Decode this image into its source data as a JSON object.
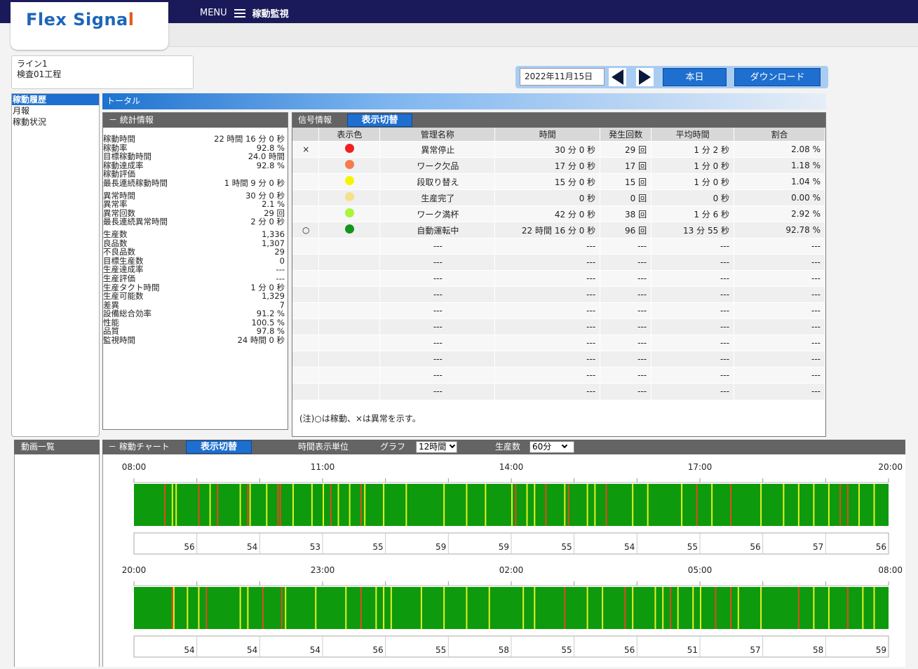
{
  "header": {
    "logo_text_a": "Flex Sig",
    "logo_text_b": "na",
    "logo_text_c": "l",
    "menu_label": "MENU",
    "page_title": "稼動監視"
  },
  "line_info": {
    "line": "ライン1",
    "process": "検査01工程"
  },
  "controls": {
    "date": "2022年11月15日",
    "today_label": "本日",
    "download_label": "ダウンロード"
  },
  "sidebar": {
    "items": [
      {
        "label": "稼動履歴",
        "active": true
      },
      {
        "label": "月報",
        "active": false
      },
      {
        "label": "稼動状況",
        "active": false
      }
    ]
  },
  "total_header": "トータル",
  "stats": {
    "title": "－ 統計情報",
    "groups": [
      [
        {
          "label": "稼動時間",
          "value": "22 時間 16 分 0 秒"
        },
        {
          "label": "稼動率",
          "value": "92.8 %"
        },
        {
          "label": "目標稼動時間",
          "value": "24.0 時間"
        },
        {
          "label": "稼動達成率",
          "value": "92.8 %"
        },
        {
          "label": "稼動評価",
          "value": ""
        },
        {
          "label": "最長連続稼動時間",
          "value": "1 時間 9 分 0 秒"
        }
      ],
      [
        {
          "label": "異常時間",
          "value": "30 分 0 秒"
        },
        {
          "label": "異常率",
          "value": "2.1 %"
        },
        {
          "label": "異常回数",
          "value": "29 回"
        },
        {
          "label": "最長連続異常時間",
          "value": "2 分 0 秒"
        }
      ],
      [
        {
          "label": "生産数",
          "value": "1,336"
        },
        {
          "label": "良品数",
          "value": "1,307"
        },
        {
          "label": "不良品数",
          "value": "29"
        },
        {
          "label": "目標生産数",
          "value": "0"
        },
        {
          "label": "生産達成率",
          "value": "---"
        },
        {
          "label": "生産評価",
          "value": "---"
        },
        {
          "label": "生産タクト時間",
          "value": "1 分 0 秒"
        },
        {
          "label": "生産可能数",
          "value": "1,329"
        },
        {
          "label": "差異",
          "value": "7"
        },
        {
          "label": "設備総合効率",
          "value": "91.2 %"
        },
        {
          "label": "性能",
          "value": "100.5 %"
        },
        {
          "label": "品質",
          "value": "97.8 %"
        },
        {
          "label": "監視時間",
          "value": "24 時間 0 秒"
        }
      ]
    ]
  },
  "signal": {
    "title": "信号情報",
    "toggle_label": "表示切替",
    "columns": [
      "",
      "表示色",
      "管理名称",
      "時間",
      "発生回数",
      "平均時間",
      "割合"
    ],
    "rows": [
      {
        "mark": "×",
        "color": "#f02020",
        "name": "異常停止",
        "time": "30 分 0 秒",
        "count": "29 回",
        "avg": "1 分 2 秒",
        "ratio": "2.08 %"
      },
      {
        "mark": "",
        "color": "#f57a4e",
        "name": "ワーク欠品",
        "time": "17 分 0 秒",
        "count": "17 回",
        "avg": "1 分 0 秒",
        "ratio": "1.18 %"
      },
      {
        "mark": "",
        "color": "#f5f500",
        "name": "段取り替え",
        "time": "15 分 0 秒",
        "count": "15 回",
        "avg": "1 分 0 秒",
        "ratio": "1.04 %"
      },
      {
        "mark": "",
        "color": "#f3e18c",
        "name": "生産完了",
        "time": "0 秒",
        "count": "0 回",
        "avg": "0 秒",
        "ratio": "0.00 %"
      },
      {
        "mark": "",
        "color": "#a8f53a",
        "name": "ワーク満杯",
        "time": "42 分 0 秒",
        "count": "38 回",
        "avg": "1 分 6 秒",
        "ratio": "2.92 %"
      },
      {
        "mark": "○",
        "color": "#13941b",
        "name": "自動運転中",
        "time": "22 時間 16 分 0 秒",
        "count": "96 回",
        "avg": "13 分 55 秒",
        "ratio": "92.78 %"
      },
      {
        "mark": "",
        "color": "",
        "name": "---",
        "time": "---",
        "count": "---",
        "avg": "---",
        "ratio": "---"
      },
      {
        "mark": "",
        "color": "",
        "name": "---",
        "time": "---",
        "count": "---",
        "avg": "---",
        "ratio": "---"
      },
      {
        "mark": "",
        "color": "",
        "name": "---",
        "time": "---",
        "count": "---",
        "avg": "---",
        "ratio": "---"
      },
      {
        "mark": "",
        "color": "",
        "name": "---",
        "time": "---",
        "count": "---",
        "avg": "---",
        "ratio": "---"
      },
      {
        "mark": "",
        "color": "",
        "name": "---",
        "time": "---",
        "count": "---",
        "avg": "---",
        "ratio": "---"
      },
      {
        "mark": "",
        "color": "",
        "name": "---",
        "time": "---",
        "count": "---",
        "avg": "---",
        "ratio": "---"
      },
      {
        "mark": "",
        "color": "",
        "name": "---",
        "time": "---",
        "count": "---",
        "avg": "---",
        "ratio": "---"
      },
      {
        "mark": "",
        "color": "",
        "name": "---",
        "time": "---",
        "count": "---",
        "avg": "---",
        "ratio": "---"
      },
      {
        "mark": "",
        "color": "",
        "name": "---",
        "time": "---",
        "count": "---",
        "avg": "---",
        "ratio": "---"
      },
      {
        "mark": "",
        "color": "",
        "name": "---",
        "time": "---",
        "count": "---",
        "avg": "---",
        "ratio": "---"
      }
    ],
    "note": "(注)○は稼動、×は異常を示す。"
  },
  "bottom": {
    "video_title": "動画一覧",
    "chart_title": "－ 稼動チャート",
    "toggle_label": "表示切替",
    "time_unit_label": "時間表示単位",
    "graph_label": "グラフ",
    "graph_value": "12時間",
    "production_label": "生産数",
    "production_value": "60分"
  },
  "colors": {
    "running": "#0d9a0d",
    "abnormal": "#e04a20",
    "fullwork": "#e8f020",
    "accent": "#1e6fcf",
    "header_bg": "#1a1a5a"
  },
  "chart_data": [
    {
      "type": "timeline",
      "time_labels": [
        "08:00",
        "11:00",
        "14:00",
        "17:00",
        "20:00"
      ],
      "hour_counts": [
        "56",
        "54",
        "53",
        "55",
        "59",
        "59",
        "55",
        "54",
        "55",
        "56",
        "57",
        "56"
      ],
      "events": [
        [
          0.04,
          "r"
        ],
        [
          0.05,
          "y"
        ],
        [
          0.055,
          "y"
        ],
        [
          0.085,
          "r"
        ],
        [
          0.1,
          "y"
        ],
        [
          0.11,
          "r"
        ],
        [
          0.14,
          "y"
        ],
        [
          0.15,
          "r"
        ],
        [
          0.153,
          "y"
        ],
        [
          0.175,
          "y"
        ],
        [
          0.19,
          "r"
        ],
        [
          0.193,
          "r"
        ],
        [
          0.21,
          "y"
        ],
        [
          0.235,
          "y"
        ],
        [
          0.25,
          "y"
        ],
        [
          0.26,
          "r"
        ],
        [
          0.27,
          "y"
        ],
        [
          0.285,
          "y"
        ],
        [
          0.3,
          "r"
        ],
        [
          0.305,
          "y"
        ],
        [
          0.33,
          "y"
        ],
        [
          0.36,
          "y"
        ],
        [
          0.41,
          "y"
        ],
        [
          0.44,
          "y"
        ],
        [
          0.465,
          "y"
        ],
        [
          0.5,
          "y"
        ],
        [
          0.505,
          "r"
        ],
        [
          0.52,
          "y"
        ],
        [
          0.53,
          "y"
        ],
        [
          0.545,
          "r"
        ],
        [
          0.57,
          "y"
        ],
        [
          0.575,
          "r"
        ],
        [
          0.6,
          "y"
        ],
        [
          0.61,
          "y"
        ],
        [
          0.625,
          "r"
        ],
        [
          0.66,
          "y"
        ],
        [
          0.68,
          "y"
        ],
        [
          0.725,
          "y"
        ],
        [
          0.745,
          "r"
        ],
        [
          0.765,
          "y"
        ],
        [
          0.79,
          "r"
        ],
        [
          0.83,
          "y"
        ],
        [
          0.86,
          "y"
        ],
        [
          0.88,
          "y"
        ],
        [
          0.9,
          "y"
        ],
        [
          0.92,
          "y"
        ],
        [
          0.935,
          "r"
        ],
        [
          0.945,
          "r"
        ],
        [
          0.96,
          "y"
        ],
        [
          0.98,
          "y"
        ]
      ]
    },
    {
      "type": "timeline",
      "time_labels": [
        "20:00",
        "23:00",
        "02:00",
        "05:00",
        "08:00"
      ],
      "hour_counts": [
        "54",
        "54",
        "54",
        "56",
        "55",
        "58",
        "55",
        "56",
        "51",
        "57",
        "58",
        "59"
      ],
      "events": [
        [
          0.05,
          "r"
        ],
        [
          0.052,
          "y"
        ],
        [
          0.07,
          "y"
        ],
        [
          0.085,
          "y"
        ],
        [
          0.095,
          "r"
        ],
        [
          0.14,
          "y"
        ],
        [
          0.15,
          "y"
        ],
        [
          0.17,
          "r"
        ],
        [
          0.195,
          "r"
        ],
        [
          0.2,
          "y"
        ],
        [
          0.24,
          "y"
        ],
        [
          0.28,
          "y"
        ],
        [
          0.3,
          "r"
        ],
        [
          0.32,
          "y"
        ],
        [
          0.33,
          "y"
        ],
        [
          0.34,
          "y"
        ],
        [
          0.38,
          "y"
        ],
        [
          0.41,
          "y"
        ],
        [
          0.44,
          "y"
        ],
        [
          0.47,
          "y"
        ],
        [
          0.515,
          "y"
        ],
        [
          0.53,
          "y"
        ],
        [
          0.57,
          "r"
        ],
        [
          0.6,
          "y"
        ],
        [
          0.62,
          "y"
        ],
        [
          0.65,
          "r"
        ],
        [
          0.66,
          "y"
        ],
        [
          0.69,
          "y"
        ],
        [
          0.7,
          "y"
        ],
        [
          0.71,
          "r"
        ],
        [
          0.72,
          "y"
        ],
        [
          0.74,
          "y"
        ],
        [
          0.75,
          "y"
        ],
        [
          0.77,
          "r"
        ],
        [
          0.79,
          "r"
        ],
        [
          0.8,
          "y"
        ],
        [
          0.83,
          "y"
        ],
        [
          0.88,
          "r"
        ],
        [
          0.9,
          "y"
        ],
        [
          0.92,
          "y"
        ],
        [
          0.945,
          "r"
        ],
        [
          0.965,
          "y"
        ],
        [
          0.98,
          "y"
        ]
      ]
    }
  ]
}
